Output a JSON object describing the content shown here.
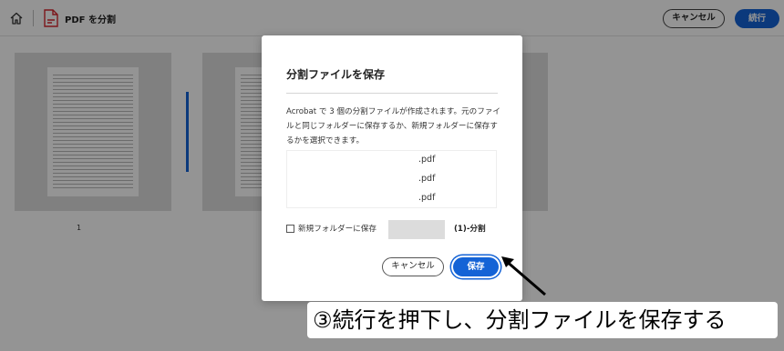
{
  "header": {
    "title": "PDF を分割",
    "cancel_label": "キャンセル",
    "continue_label": "続行"
  },
  "pages": {
    "first_page_number": "1"
  },
  "dialog": {
    "title": "分割ファイルを保存",
    "description": "Acrobat で 3 個の分割ファイルが作成されます。元のファイルと同じフォルダーに保存するか、新規フォルダーに保存するかを選択できます。",
    "files": [
      ".pdf",
      ".pdf",
      ".pdf"
    ],
    "checkbox_label": "新規フォルダーに保存",
    "folder_suffix": "(1)-分割",
    "cancel_label": "キャンセル",
    "save_label": "保存"
  },
  "annotation": {
    "text": "③続行を押下し、分割ファイルを保存する"
  },
  "colors": {
    "accent": "#1463d6",
    "tool_icon": "#d6262f"
  }
}
